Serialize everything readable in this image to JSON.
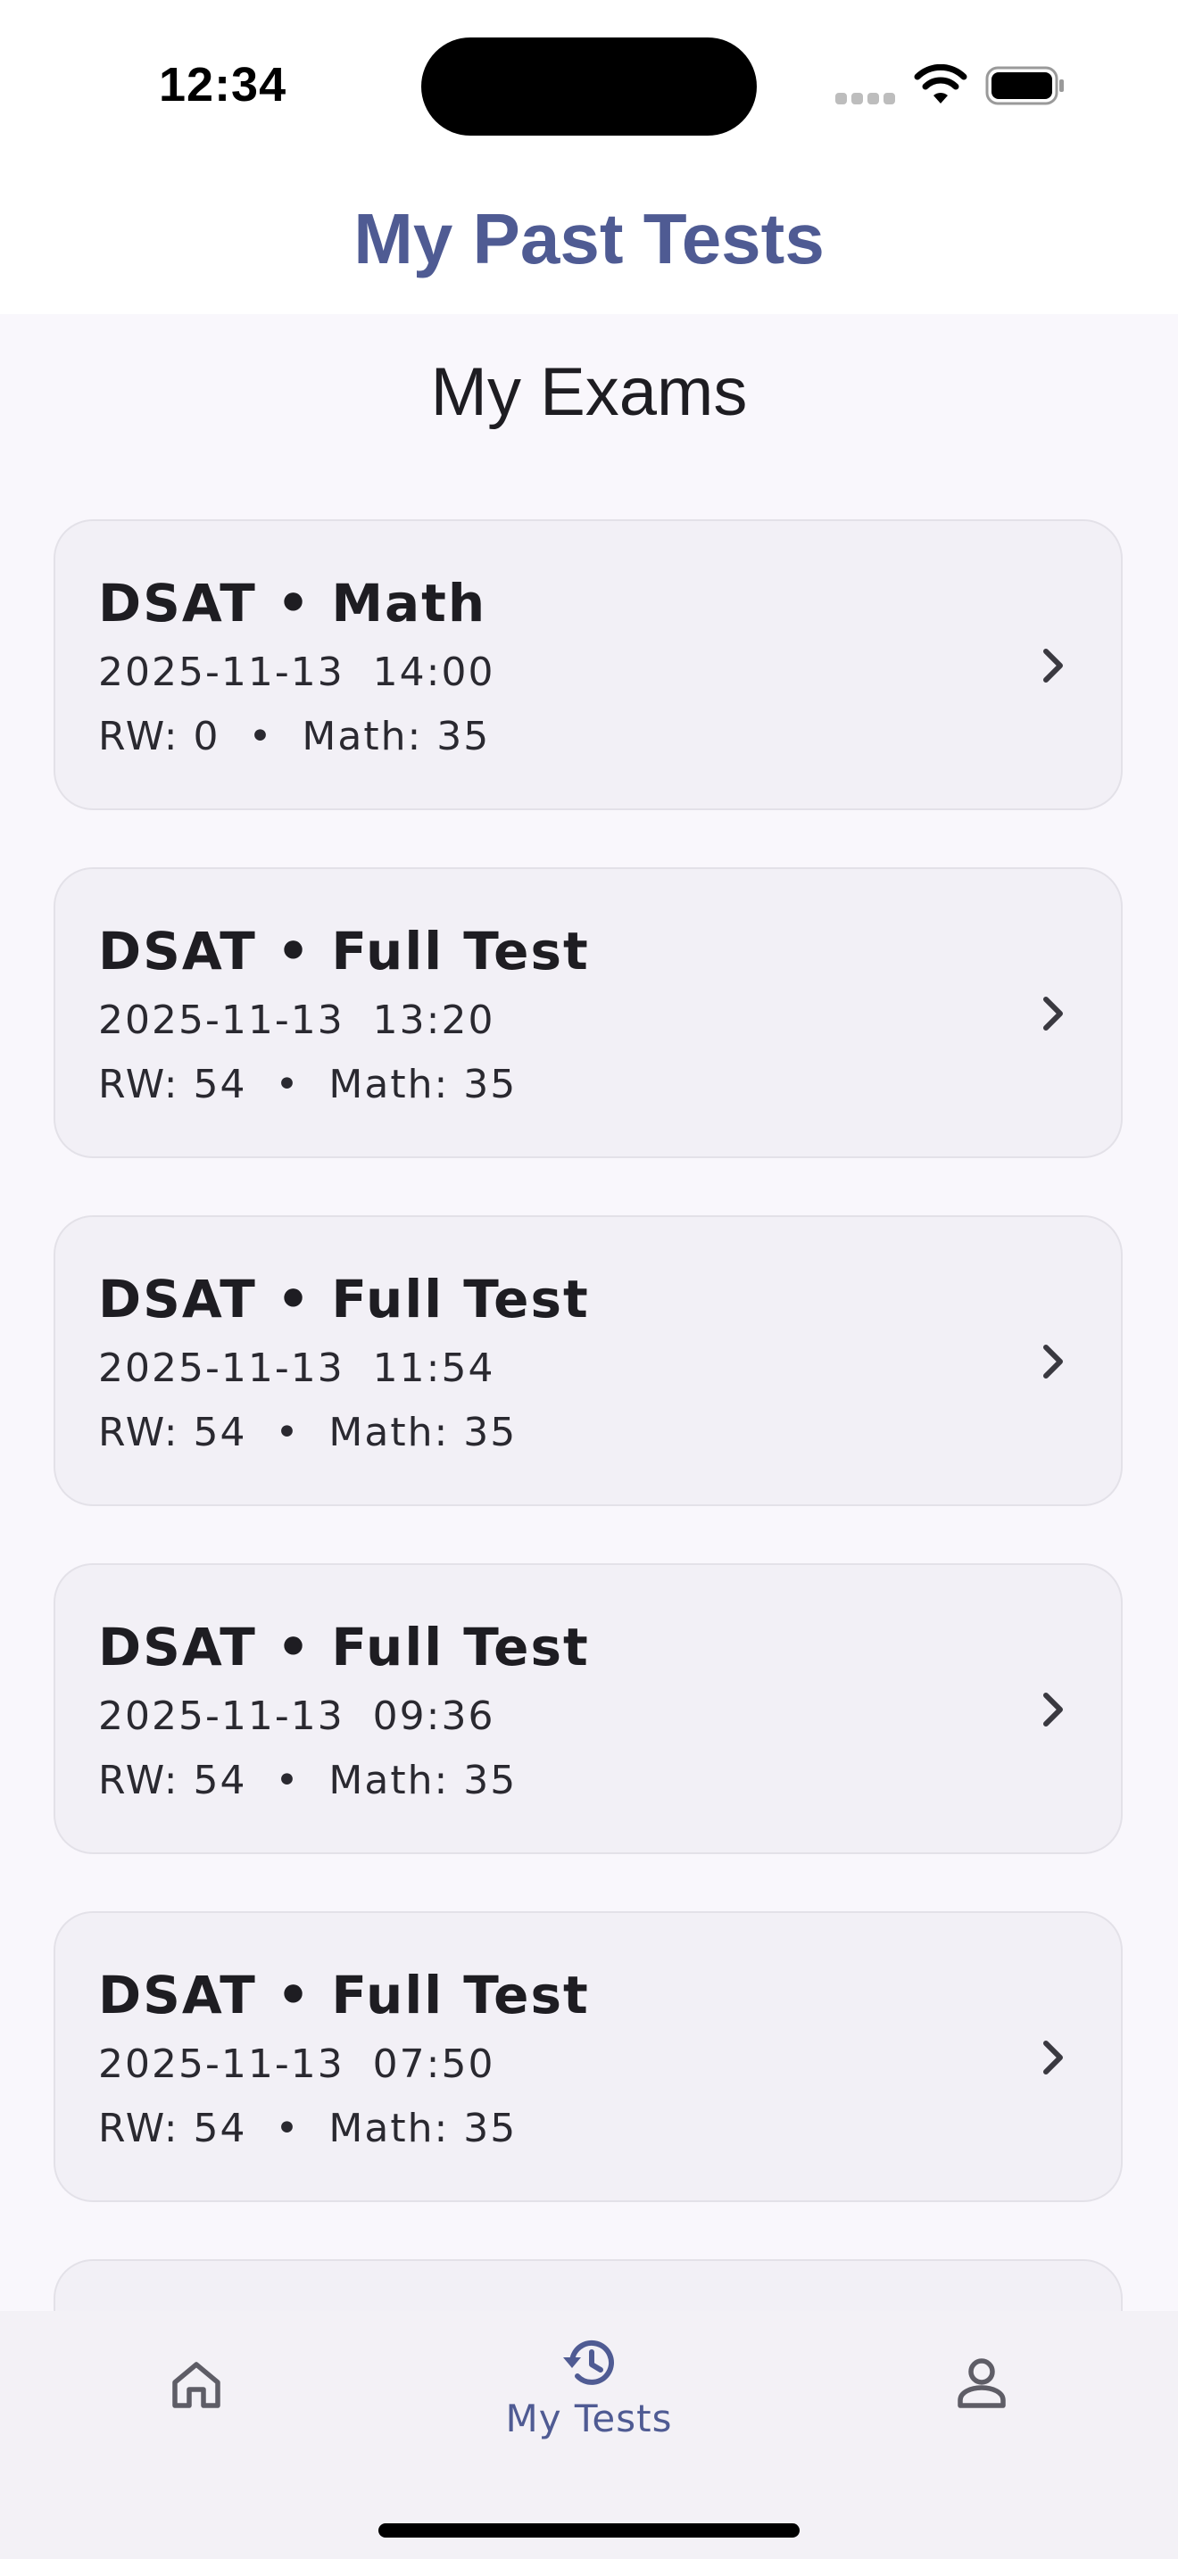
{
  "status_bar": {
    "time": "12:34"
  },
  "app_bar": {
    "title": "My Past Tests"
  },
  "section": {
    "title": "My Exams"
  },
  "exams": [
    {
      "title": "DSAT • Math",
      "date": "2025-11-13  14:00",
      "scores": "RW: 0  •  Math: 35"
    },
    {
      "title": "DSAT • Full Test",
      "date": "2025-11-13  13:20",
      "scores": "RW: 54  •  Math: 35"
    },
    {
      "title": "DSAT • Full Test",
      "date": "2025-11-13  11:54",
      "scores": "RW: 54  •  Math: 35"
    },
    {
      "title": "DSAT • Full Test",
      "date": "2025-11-13  09:36",
      "scores": "RW: 54  •  Math: 35"
    },
    {
      "title": "DSAT • Full Test",
      "date": "2025-11-13  07:50",
      "scores": "RW: 54  •  Math: 35"
    }
  ],
  "bottom_nav": {
    "items": [
      {
        "icon": "home-icon",
        "label": ""
      },
      {
        "icon": "history-icon",
        "label": "My Tests",
        "selected": true
      },
      {
        "icon": "person-icon",
        "label": ""
      }
    ]
  },
  "colors": {
    "accent": "#4F5B93",
    "background": "#F9F7FC",
    "card": "#F2F0F6",
    "nav_background": "#F3F1F6"
  }
}
